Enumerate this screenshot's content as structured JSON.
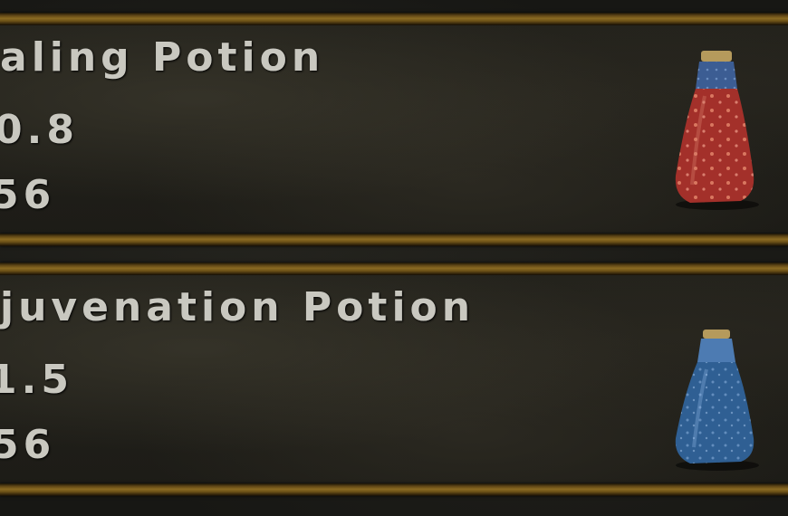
{
  "items": [
    {
      "name": "aling Potion",
      "stat1": "0.8",
      "stat2": "56",
      "icon": "red-potion-icon",
      "liquid_color": "#a3302a",
      "neck_color": "#3c5d93"
    },
    {
      "name": "juvenation Potion",
      "stat1": "1.5",
      "stat2": "56",
      "icon": "blue-potion-icon",
      "liquid_color": "#2f5f93",
      "neck_color": "#4d7bb2"
    }
  ]
}
